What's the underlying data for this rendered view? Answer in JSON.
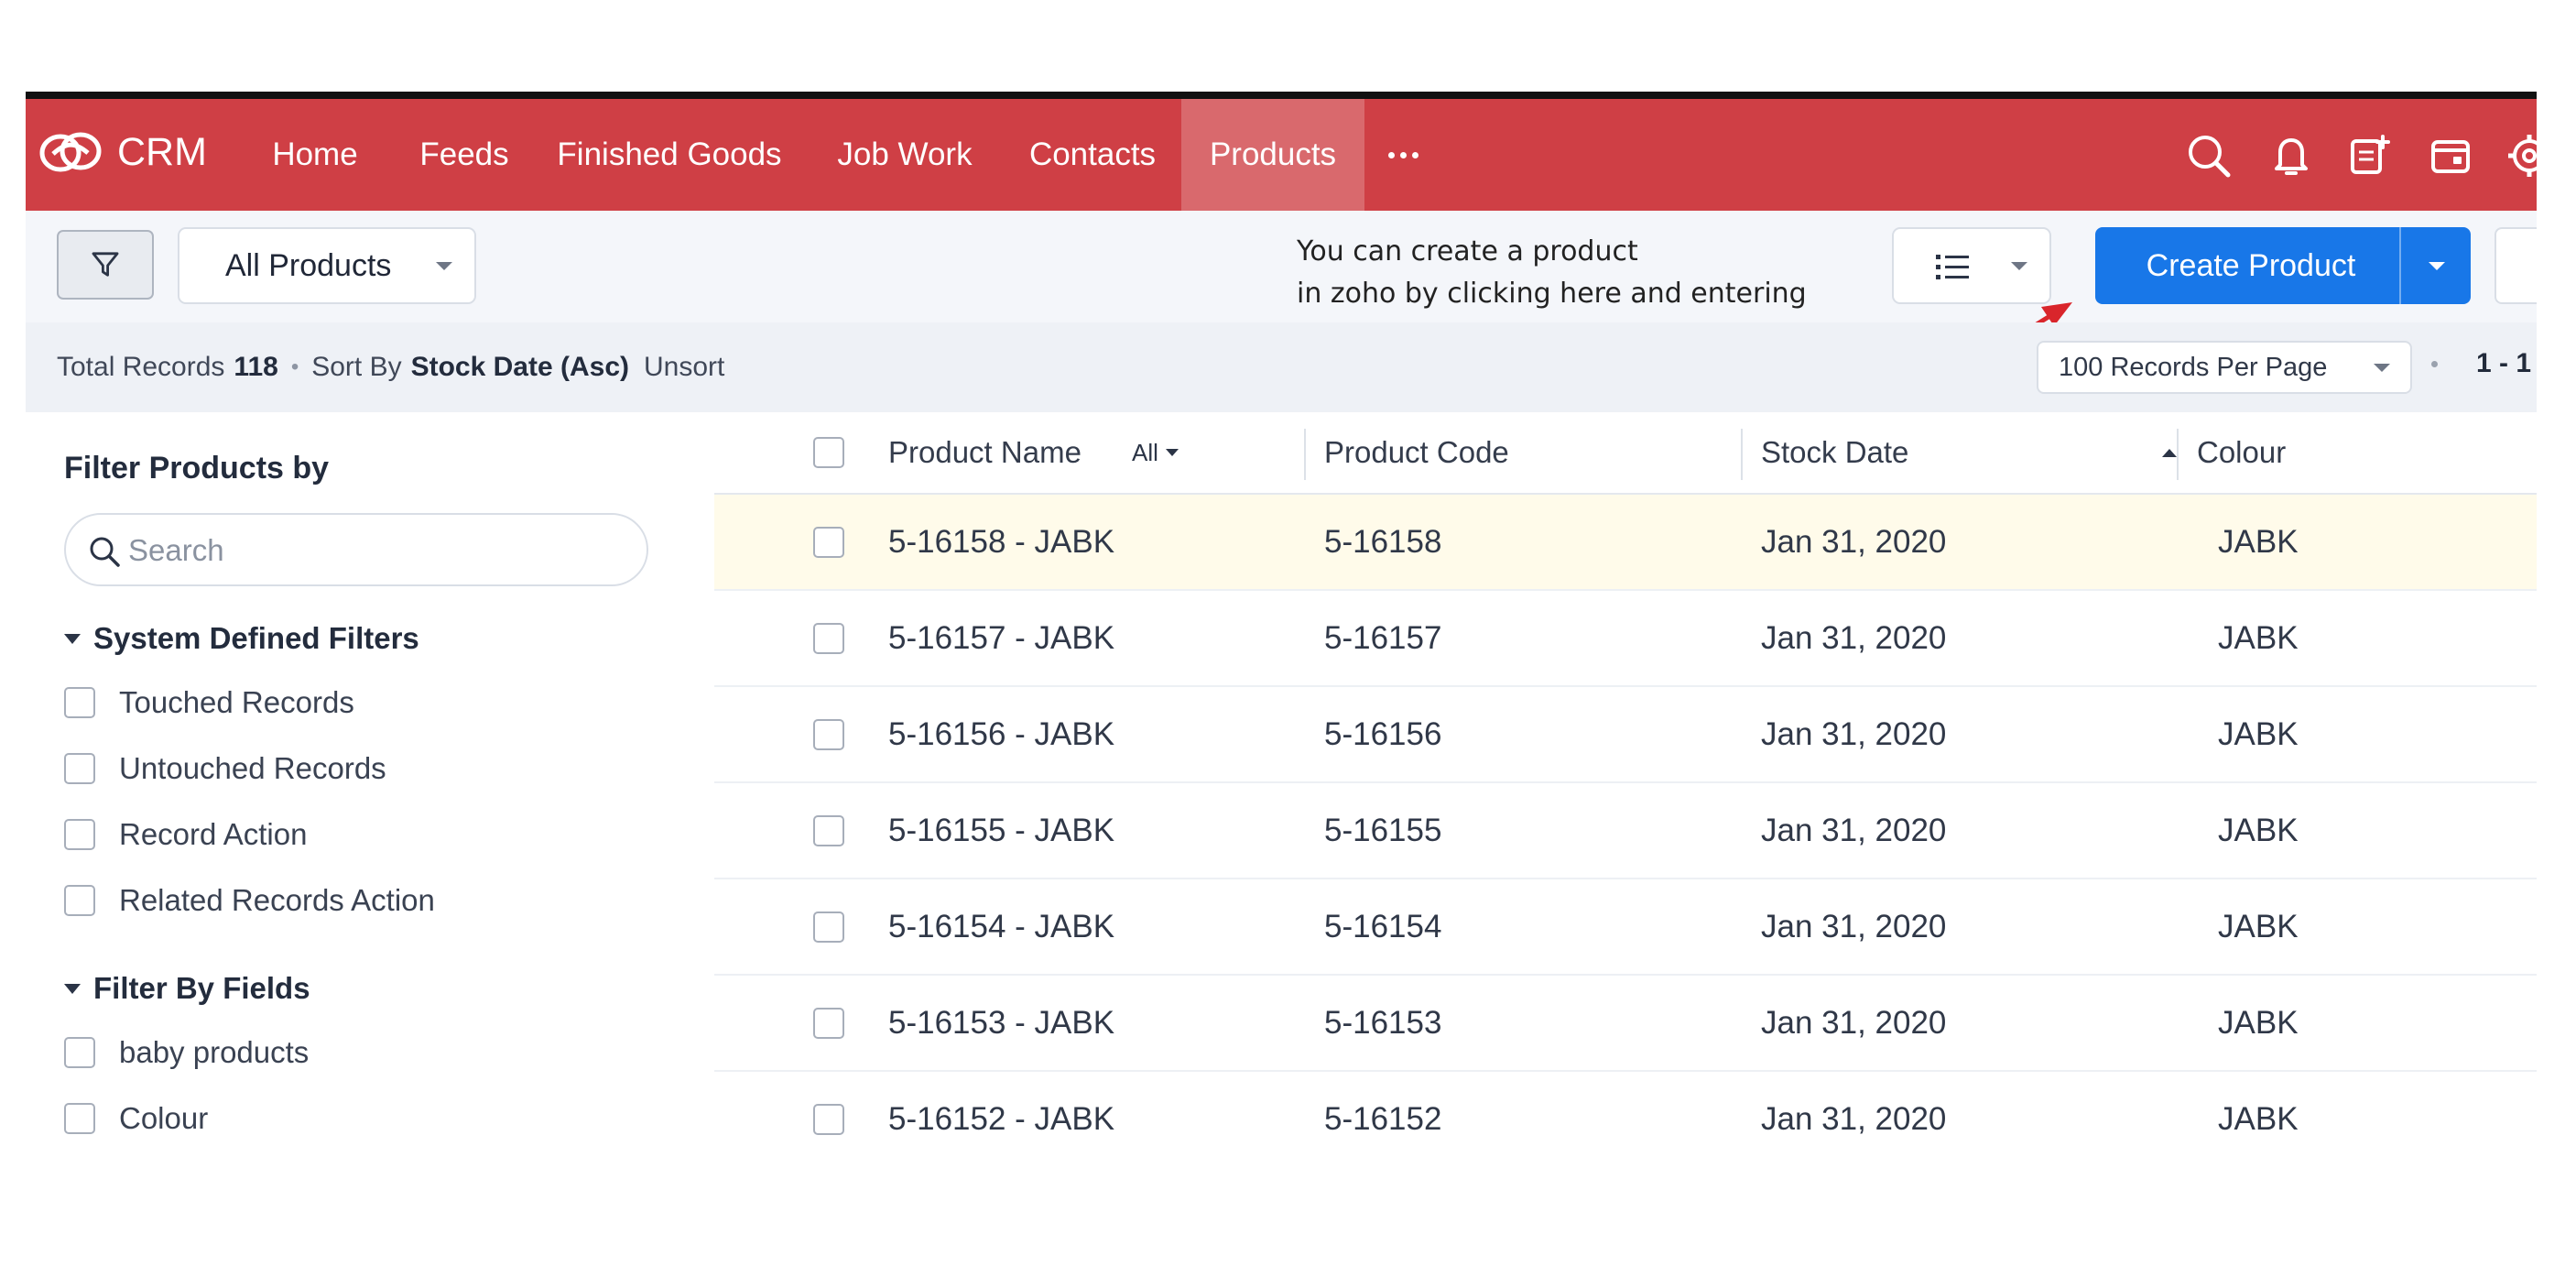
{
  "app": {
    "brand": "CRM"
  },
  "nav": {
    "items": [
      {
        "label": "Home",
        "active": false
      },
      {
        "label": "Feeds",
        "active": false
      },
      {
        "label": "Finished Goods",
        "active": false
      },
      {
        "label": "Job Work",
        "active": false
      },
      {
        "label": "Contacts",
        "active": false
      },
      {
        "label": "Products",
        "active": true
      }
    ],
    "more_icon": "more-dots-icon",
    "right_icons": [
      "search-icon",
      "notification-bell-icon",
      "calendar-add-icon",
      "calendar-icon",
      "settings-gear-icon"
    ]
  },
  "toolbar": {
    "filter_icon": "filter-icon",
    "view_label": "All Products",
    "annotation": "You can create a product\nin zoho by clicking here and entering\n the product details.",
    "list_view_icon": "list-view-icon",
    "create_label": "Create Product"
  },
  "summary": {
    "total_label": "Total Records",
    "total_count": "118",
    "sort_label": "Sort By",
    "sort_value": "Stock Date (Asc)",
    "unsort_label": "Unsort",
    "per_page_label": "100 Records Per Page",
    "page_range": "1 - 1"
  },
  "filters": {
    "title": "Filter Products by",
    "search_placeholder": "Search",
    "system_group": "System Defined Filters",
    "system_items": [
      "Touched Records",
      "Untouched Records",
      "Record Action",
      "Related Records Action"
    ],
    "field_group": "Filter By Fields",
    "field_items": [
      "baby products",
      "Colour"
    ]
  },
  "table": {
    "columns": [
      "Product Name",
      "Product Code",
      "Stock Date",
      "Colour"
    ],
    "all_label": "All",
    "rows": [
      [
        "5-16158 - JABK",
        "5-16158",
        "Jan 31, 2020",
        "JABK"
      ],
      [
        "5-16157 - JABK",
        "5-16157",
        "Jan 31, 2020",
        "JABK"
      ],
      [
        "5-16156 - JABK",
        "5-16156",
        "Jan 31, 2020",
        "JABK"
      ],
      [
        "5-16155 - JABK",
        "5-16155",
        "Jan 31, 2020",
        "JABK"
      ],
      [
        "5-16154 - JABK",
        "5-16154",
        "Jan 31, 2020",
        "JABK"
      ],
      [
        "5-16153 - JABK",
        "5-16153",
        "Jan 31, 2020",
        "JABK"
      ],
      [
        "5-16152 - JABK",
        "5-16152",
        "Jan 31, 2020",
        "JABK"
      ]
    ]
  },
  "colors": {
    "accent_red": "#cf3f45",
    "primary_blue": "#1877e8",
    "annotation_arrow": "#d9252b",
    "row_highlight": "#fffbea"
  }
}
